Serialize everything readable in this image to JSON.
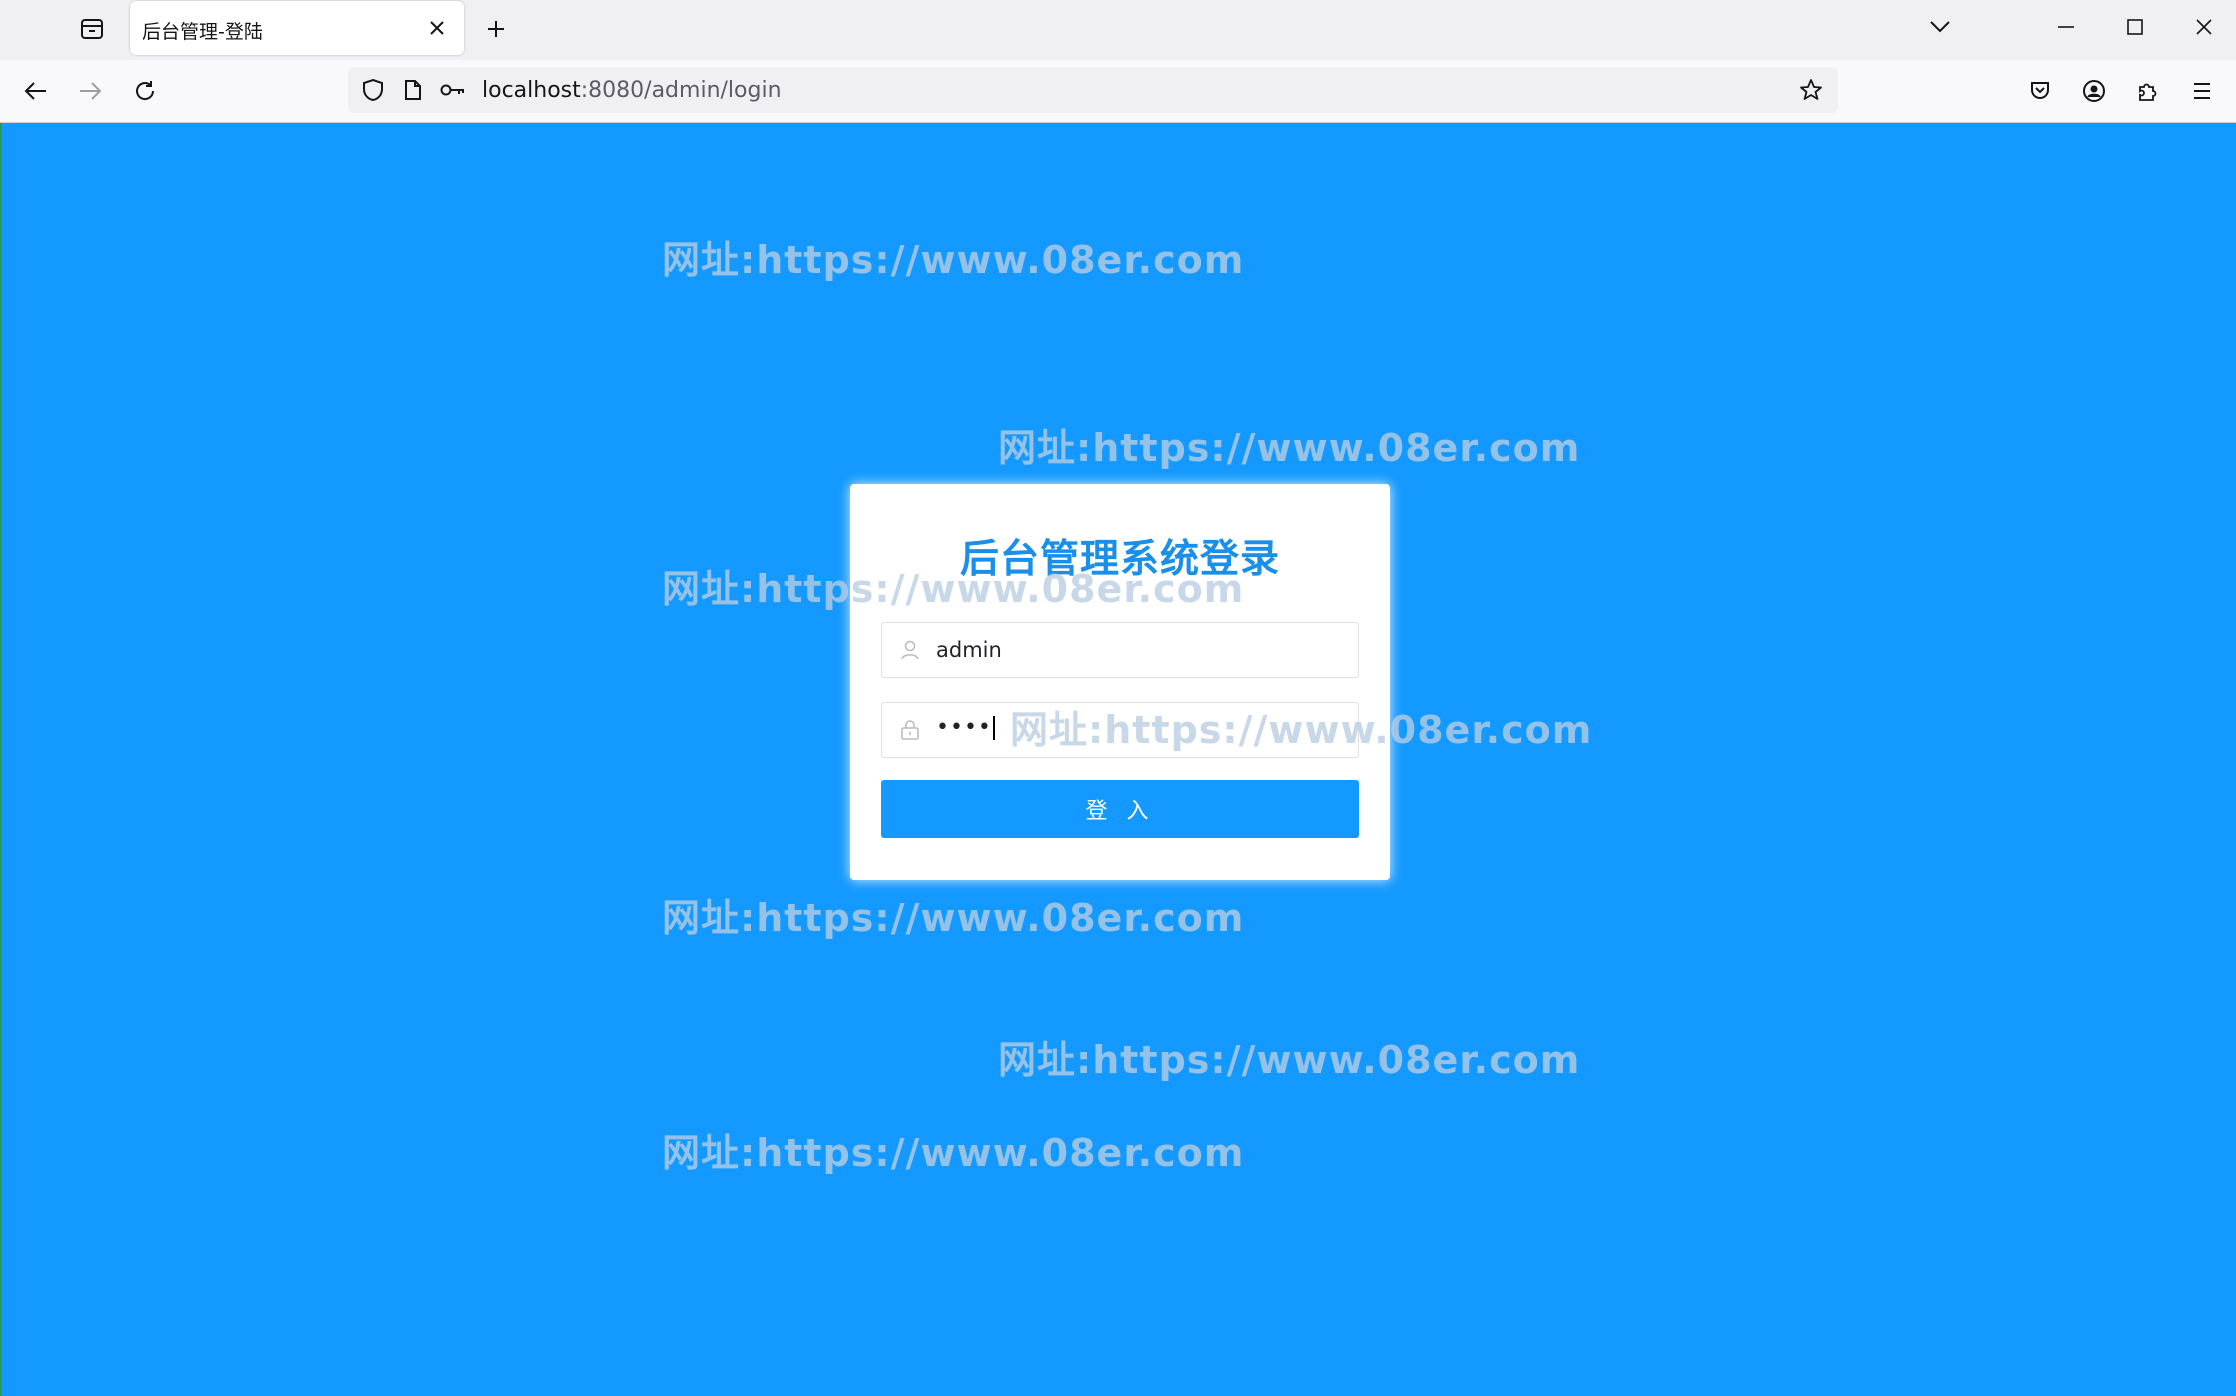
{
  "browser": {
    "tab": {
      "title": "后台管理-登陆"
    },
    "url": {
      "host": "localhost",
      "rest": ":8080/admin/login"
    },
    "icons": {
      "tab_overview": "tab-overview-icon",
      "close_tab": "close-icon",
      "new_tab": "plus-icon",
      "list_all_tabs": "chevron-down-icon",
      "minimize": "minimize-icon",
      "maximize": "maximize-icon",
      "close_window": "close-icon",
      "back": "arrow-left-icon",
      "forward": "arrow-right-icon",
      "reload": "reload-icon",
      "tracking_protection": "shield-icon",
      "page_info": "page-icon",
      "permissions": "key-icon",
      "bookmark": "star-icon",
      "pocket": "pocket-icon",
      "account": "account-icon",
      "extensions": "puzzle-icon",
      "menu": "hamburger-menu-icon"
    }
  },
  "page": {
    "background_color": "#1399ff",
    "login": {
      "title": "后台管理系统登录",
      "username": "admin",
      "password_masked": "••••",
      "submit_label": "登 入",
      "user_icon": "user-icon",
      "lock_icon": "lock-icon"
    },
    "watermark": "网址:https://www.08er.com"
  }
}
